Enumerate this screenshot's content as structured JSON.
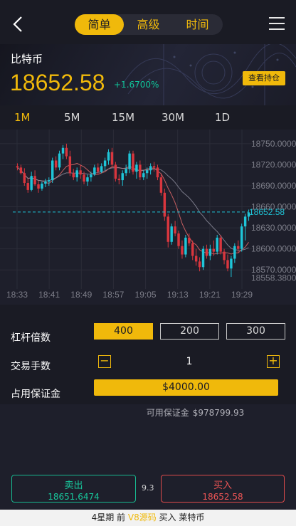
{
  "header": {
    "tabs": [
      "简单",
      "高级",
      "时间"
    ],
    "active_tab": 0
  },
  "asset": {
    "name": "比特币",
    "price": "18652.58",
    "change": "+1.6700%",
    "positions_button": "查看持仓"
  },
  "timeframes": [
    "1M",
    "5M",
    "15M",
    "30M",
    "1D"
  ],
  "active_timeframe": 0,
  "chart_data": {
    "type": "candlestick",
    "x_ticks": [
      "18:33",
      "18:41",
      "18:49",
      "18:57",
      "19:05",
      "19:13",
      "19:21",
      "19:29"
    ],
    "y_ticks": [
      "18750.0000",
      "18720.0000",
      "18690.0000",
      "18660.0000",
      "18630.0000",
      "18600.0000",
      "18570.0000",
      "18558.3800"
    ],
    "ylim": [
      18555,
      18760
    ],
    "current_price_label": "18652.58",
    "current_price": 18652.58,
    "colors": {
      "up": "#1fc5d8",
      "down": "#d9363e",
      "price_line": "#1fc5d8",
      "ma": [
        "#e46a6a",
        "#8b8b9a"
      ]
    },
    "candles": [
      [
        18718,
        18722,
        18712,
        18716
      ],
      [
        18716,
        18720,
        18706,
        18708
      ],
      [
        18708,
        18715,
        18690,
        18694
      ],
      [
        18694,
        18700,
        18680,
        18684
      ],
      [
        18684,
        18710,
        18682,
        18704
      ],
      [
        18704,
        18712,
        18690,
        18692
      ],
      [
        18692,
        18697,
        18680,
        18686
      ],
      [
        18686,
        18696,
        18683,
        18693
      ],
      [
        18693,
        18700,
        18688,
        18696
      ],
      [
        18696,
        18702,
        18690,
        18698
      ],
      [
        18698,
        18730,
        18694,
        18726
      ],
      [
        18726,
        18732,
        18712,
        18716
      ],
      [
        18716,
        18740,
        18712,
        18736
      ],
      [
        18736,
        18748,
        18728,
        18744
      ],
      [
        18744,
        18750,
        18728,
        18732
      ],
      [
        18732,
        18740,
        18704,
        18708
      ],
      [
        18708,
        18714,
        18698,
        18702
      ],
      [
        18702,
        18716,
        18696,
        18712
      ],
      [
        18712,
        18720,
        18700,
        18706
      ],
      [
        18706,
        18710,
        18692,
        18696
      ],
      [
        18696,
        18706,
        18690,
        18702
      ],
      [
        18702,
        18710,
        18696,
        18706
      ],
      [
        18706,
        18720,
        18704,
        18716
      ],
      [
        18716,
        18722,
        18706,
        18710
      ],
      [
        18710,
        18722,
        18708,
        18718
      ],
      [
        18718,
        18730,
        18712,
        18726
      ],
      [
        18726,
        18742,
        18720,
        18738
      ],
      [
        18738,
        18744,
        18716,
        18720
      ],
      [
        18720,
        18724,
        18696,
        18700
      ],
      [
        18700,
        18706,
        18692,
        18698
      ],
      [
        18698,
        18712,
        18690,
        18708
      ],
      [
        18708,
        18720,
        18704,
        18714
      ],
      [
        18714,
        18740,
        18708,
        18736
      ],
      [
        18736,
        18740,
        18706,
        18710
      ],
      [
        18710,
        18724,
        18700,
        18720
      ],
      [
        18720,
        18726,
        18698,
        18702
      ],
      [
        18702,
        18712,
        18698,
        18708
      ],
      [
        18708,
        18716,
        18700,
        18712
      ],
      [
        18712,
        18722,
        18706,
        18718
      ],
      [
        18718,
        18724,
        18710,
        18716
      ],
      [
        18716,
        18720,
        18698,
        18702
      ],
      [
        18702,
        18706,
        18676,
        18680
      ],
      [
        18680,
        18686,
        18640,
        18646
      ],
      [
        18646,
        18650,
        18602,
        18610
      ],
      [
        18610,
        18636,
        18606,
        18632
      ],
      [
        18632,
        18640,
        18618,
        18622
      ],
      [
        18622,
        18626,
        18600,
        18604
      ],
      [
        18604,
        18612,
        18586,
        18592
      ],
      [
        18592,
        18620,
        18588,
        18616
      ],
      [
        18616,
        18622,
        18604,
        18608
      ],
      [
        18608,
        18612,
        18584,
        18590
      ],
      [
        18590,
        18600,
        18576,
        18582
      ],
      [
        18582,
        18588,
        18568,
        18574
      ],
      [
        18574,
        18604,
        18570,
        18600
      ],
      [
        18600,
        18606,
        18586,
        18590
      ],
      [
        18590,
        18606,
        18584,
        18600
      ],
      [
        18600,
        18612,
        18590,
        18596
      ],
      [
        18596,
        18620,
        18592,
        18616
      ],
      [
        18616,
        18620,
        18592,
        18596
      ],
      [
        18596,
        18600,
        18578,
        18584
      ],
      [
        18584,
        18592,
        18568,
        18572
      ],
      [
        18572,
        18590,
        18560,
        18586
      ],
      [
        18586,
        18608,
        18580,
        18604
      ],
      [
        18604,
        18612,
        18594,
        18600
      ],
      [
        18600,
        18636,
        18596,
        18632
      ],
      [
        18632,
        18650,
        18612,
        18646
      ],
      [
        18646,
        18656,
        18640,
        18652
      ]
    ]
  },
  "form": {
    "leverage_label": "杠杆倍数",
    "leverage_options": [
      "400",
      "200",
      "300"
    ],
    "active_leverage": 0,
    "lots_label": "交易手数",
    "lots_value": "1",
    "minus": "−",
    "plus": "+",
    "margin_label": "占用保证金",
    "margin_value": "$4000.00"
  },
  "available": {
    "label": "可用保证金",
    "value": "$978799.93"
  },
  "trade": {
    "sell_label": "卖出",
    "sell_price": "18651.6474",
    "spread": "9.3",
    "buy_label": "买入",
    "buy_price": "18652.58"
  },
  "footer": {
    "text_a": "4星期 前 ",
    "watermark": "V8源码",
    "text_b": " 买入 莱特币"
  }
}
